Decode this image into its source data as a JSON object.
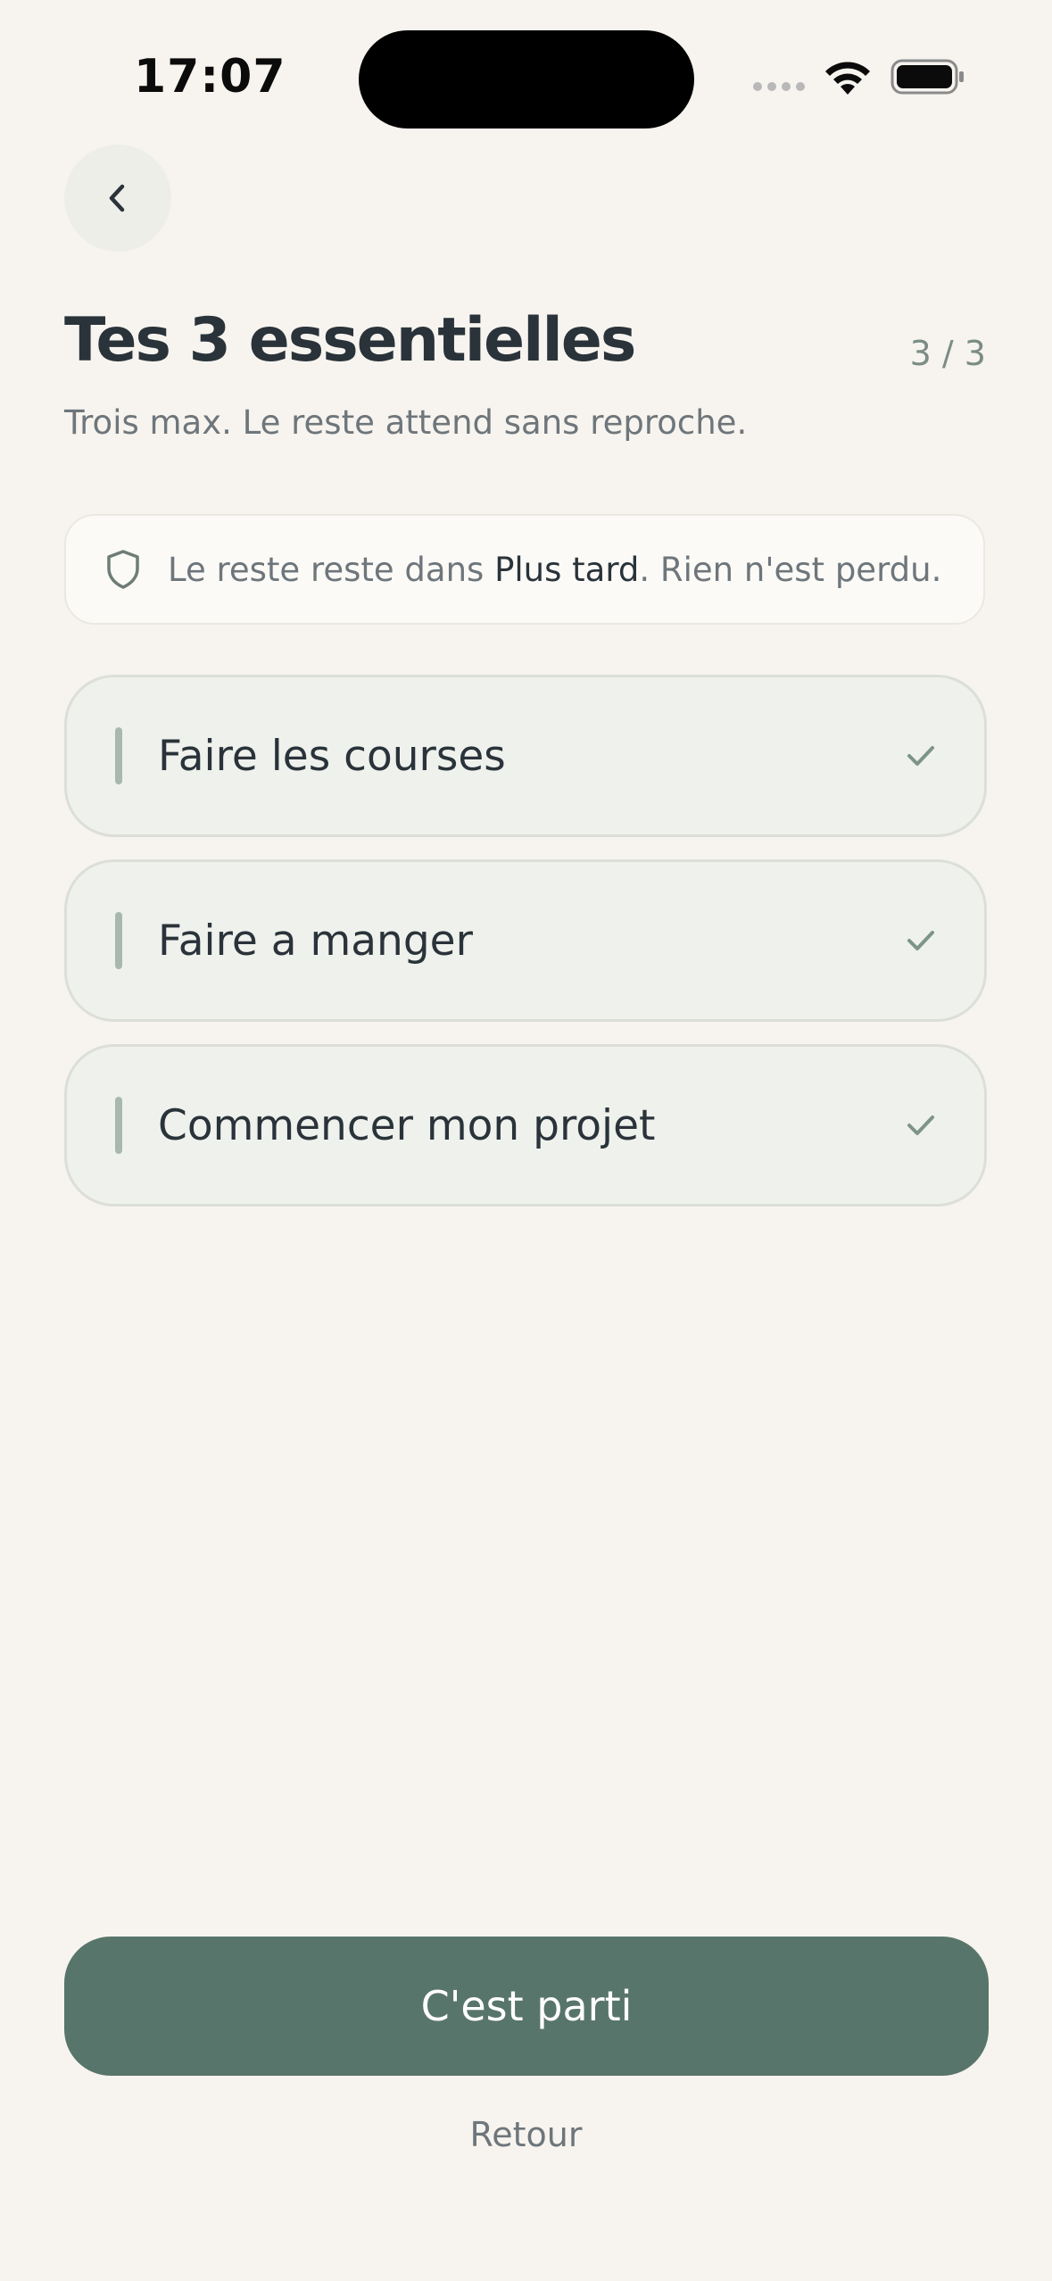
{
  "status_bar": {
    "time": "17:07"
  },
  "header": {
    "title": "Tes 3 essentielles",
    "step": "3 / 3",
    "subtitle": "Trois max. Le reste attend sans reproche."
  },
  "info_banner": {
    "text_before": "Le reste reste dans ",
    "highlight": "Plus tard",
    "text_after": ". Rien n'est perdu."
  },
  "tasks": [
    {
      "label": "Faire les courses",
      "checked": true
    },
    {
      "label": "Faire a manger",
      "checked": true
    },
    {
      "label": "Commencer mon projet",
      "checked": true
    }
  ],
  "actions": {
    "primary_label": "C'est parti",
    "secondary_label": "Retour"
  },
  "colors": {
    "background": "#f7f4ef",
    "accent": "#58756b",
    "card": "#eff1ec",
    "text": "#2a333a",
    "muted": "#6e767b"
  },
  "icons": {
    "back": "chevron-left-icon",
    "banner": "shield-icon",
    "task": "check-icon"
  }
}
